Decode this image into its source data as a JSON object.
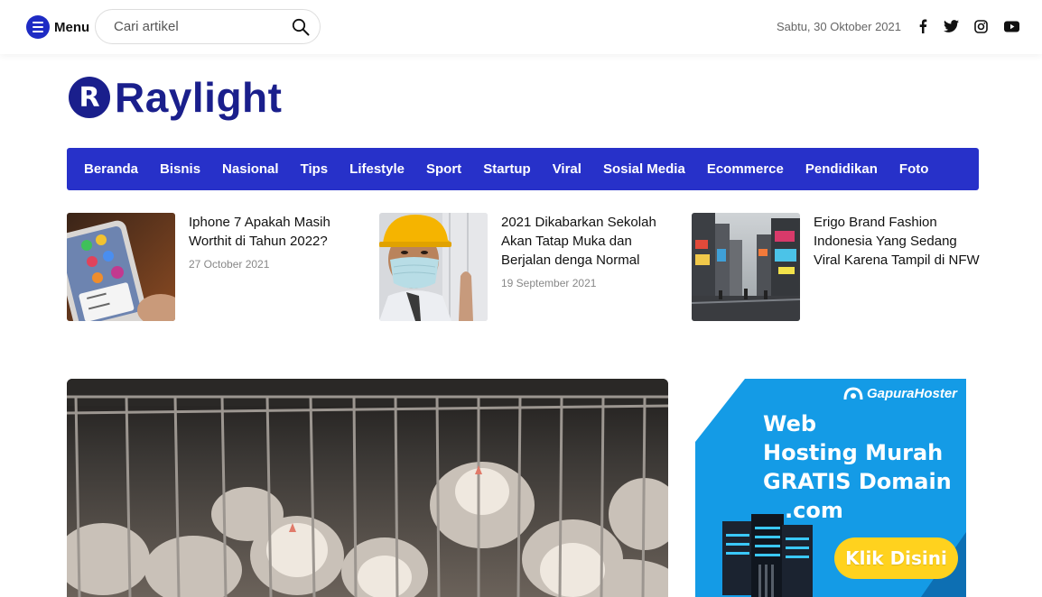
{
  "header": {
    "menu_label": "Menu",
    "search_placeholder": "Cari artikel",
    "date": "Sabtu, 30 Oktober 2021",
    "social": [
      "facebook-icon",
      "twitter-icon",
      "instagram-icon",
      "youtube-icon"
    ]
  },
  "logo": {
    "mark": "R",
    "name": "Raylight"
  },
  "nav": [
    "Beranda",
    "Bisnis",
    "Nasional",
    "Tips",
    "Lifestyle",
    "Sport",
    "Startup",
    "Viral",
    "Sosial Media",
    "Ecommerce",
    "Pendidikan",
    "Foto"
  ],
  "trending": [
    {
      "title": "Iphone 7 Apakah Masih Worthit di Tahun 2022?",
      "date": "27 October 2021"
    },
    {
      "title": "2021 Dikabarkan Sekolah Akan Tatap Muka dan Berjalan denga Normal",
      "date": "19 September 2021"
    },
    {
      "title": "Erigo Brand Fashion Indonesia Yang Sedang Viral Karena Tampil di NFW",
      "date": ""
    }
  ],
  "ad": {
    "brand": "GapuraHoster",
    "line1": "Web",
    "line2": "Hosting Murah",
    "line3": "GRATIS Domain",
    "line4": ".com",
    "button": "Klik Disini"
  },
  "colors": {
    "primary": "#2731c9",
    "logo": "#1a1f8c",
    "ad_bg": "#149be6",
    "ad_button": "#ffd21e"
  }
}
